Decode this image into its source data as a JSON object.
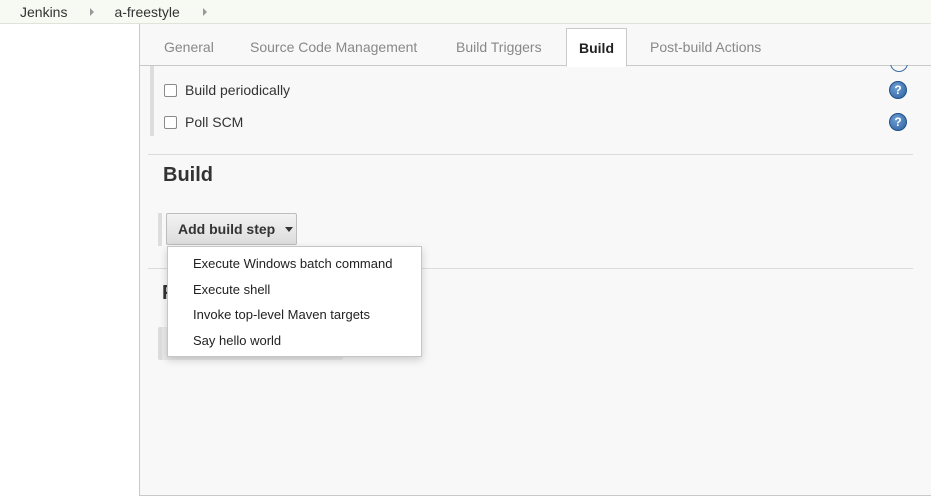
{
  "breadcrumb": {
    "items": [
      {
        "label": "Jenkins"
      },
      {
        "label": "a-freestyle"
      }
    ]
  },
  "tabs": [
    {
      "label": "General"
    },
    {
      "label": "Source Code Management"
    },
    {
      "label": "Build Triggers"
    },
    {
      "label": "Build",
      "active": true
    },
    {
      "label": "Post-build Actions"
    }
  ],
  "triggers": {
    "options": [
      {
        "label": "Build periodically",
        "checked": false
      },
      {
        "label": "Poll SCM",
        "checked": false
      }
    ],
    "help_glyph": "?"
  },
  "build": {
    "title": "Build",
    "add_step_label": "Add build step",
    "menu": [
      {
        "label": "Execute Windows batch command"
      },
      {
        "label": "Execute shell"
      },
      {
        "label": "Invoke top-level Maven targets"
      },
      {
        "label": "Say hello world"
      }
    ]
  },
  "post_build": {
    "title_partial": "P"
  },
  "colors": {
    "accent_help": "#2c5f9e",
    "breadcrumb_bg": "#f6faf2",
    "panel_bg": "#f8f8f8"
  }
}
